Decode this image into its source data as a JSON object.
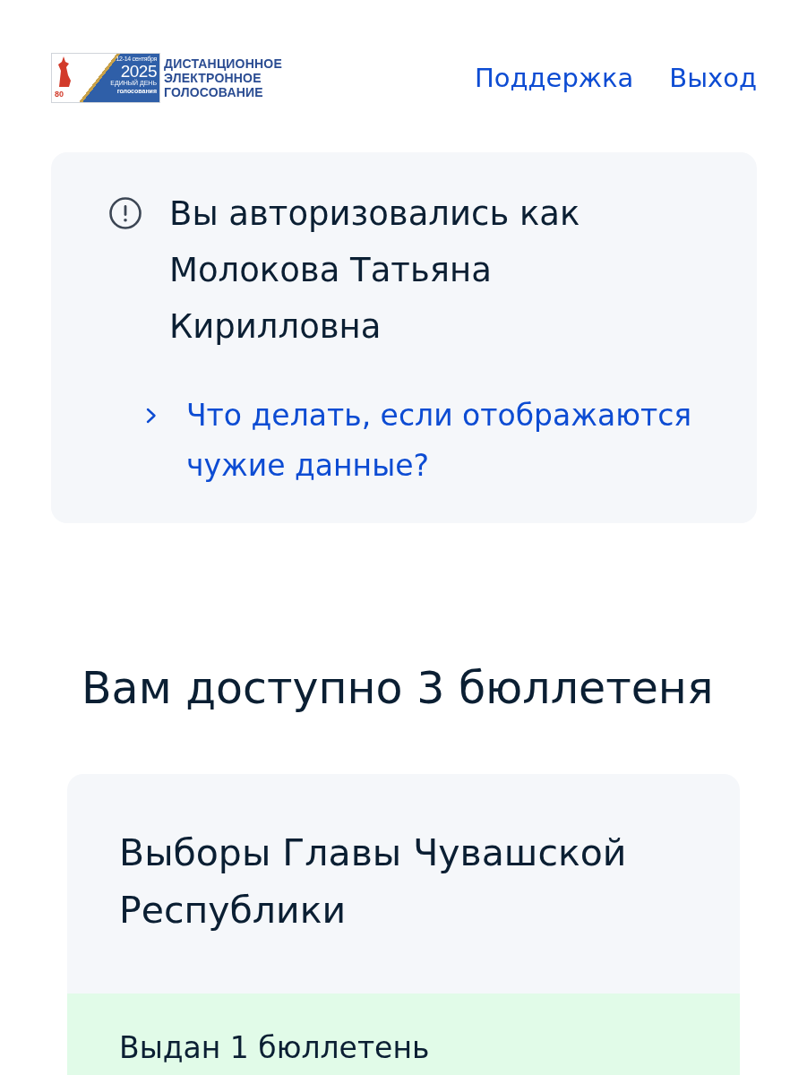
{
  "header": {
    "logo": {
      "badge": "80",
      "date": "12-14 сентября",
      "year": "2025",
      "line1": "ЕДИНЫЙ ДЕНЬ",
      "line2": "голосования"
    },
    "title_lines": [
      "ДИСТАНЦИОННОЕ",
      "ЭЛЕКТРОННОЕ",
      "ГОЛОСОВАНИЕ"
    ],
    "nav": [
      "Поддержка",
      "Выход"
    ]
  },
  "auth_notice": {
    "text": "Вы авторизовались как Молокова Татьяна Кирилловна",
    "help_link": "Что делать, если отображаются чужие данные?"
  },
  "heading": "Вам доступно 3 бюллетеня",
  "elections": [
    {
      "title": "Выборы Главы Чувашской Республики",
      "status": "Выдан 1 бюллетень"
    }
  ]
}
